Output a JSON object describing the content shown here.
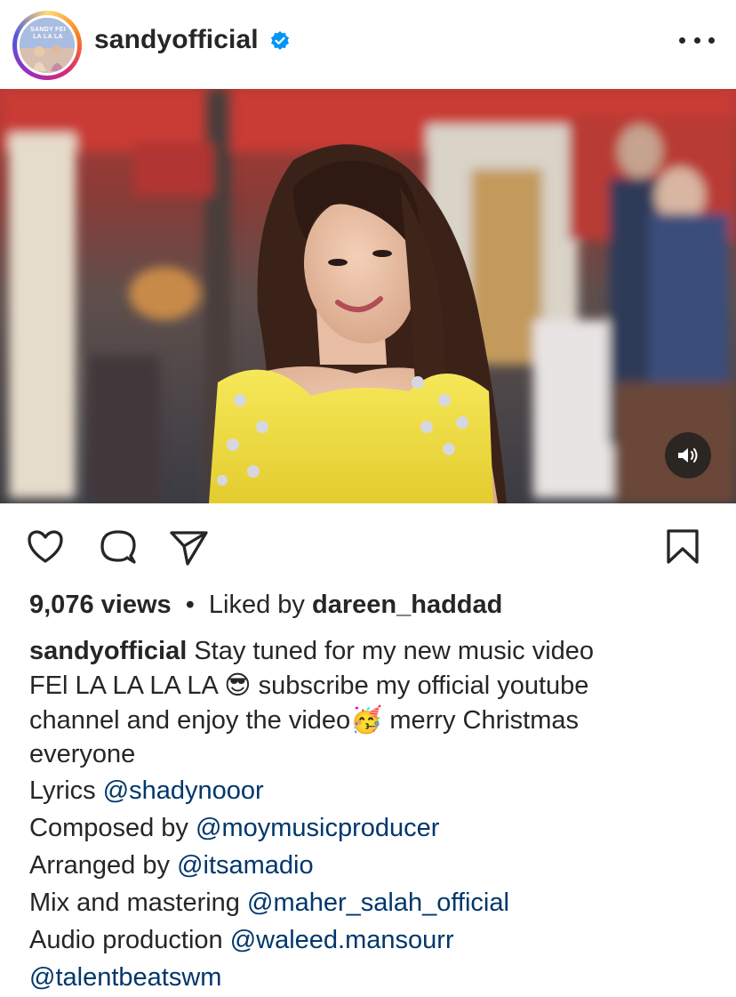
{
  "header": {
    "avatar_text": "SANDY FEI LA LA LA",
    "username": "sandyofficial",
    "verified_icon": "verified-badge-icon",
    "more_icon": "more-options-icon"
  },
  "media": {
    "type": "video",
    "sound_icon": "speaker-volume-icon"
  },
  "actions": {
    "like_icon": "heart-icon",
    "comment_icon": "comment-bubble-icon",
    "share_icon": "paper-plane-icon",
    "save_icon": "bookmark-icon"
  },
  "stats": {
    "views": "9,076 views",
    "separator": "•",
    "liked_by_prefix": "Liked by",
    "liked_by_user": "dareen_haddad"
  },
  "caption": {
    "user": "sandyofficial",
    "line1": "Stay tuned for my new music video",
    "line2a": "FEl LA LA LA LA",
    "emoji1": "😎",
    "line2b": "subscribe my official youtube",
    "line3a": "channel  and enjoy the video",
    "emoji2": "🥳",
    "line3b": "merry Christmas",
    "line4": "everyone"
  },
  "credits": [
    {
      "label": "Lyrics",
      "mention": "@shadynooor"
    },
    {
      "label": "Composed by",
      "mention": "@moymusicproducer"
    },
    {
      "label": "Arranged by",
      "mention": "@itsamadio"
    },
    {
      "label": "Mix and mastering",
      "mention": "@maher_salah_official"
    },
    {
      "label": "Audio production",
      "mention": "@waleed.mansourr"
    },
    {
      "label": "",
      "mention": "@talentbeatswm"
    }
  ],
  "colors": {
    "text": "#262626",
    "mention": "#00376b",
    "verified": "#0095f6",
    "dress": "#f3e146"
  }
}
